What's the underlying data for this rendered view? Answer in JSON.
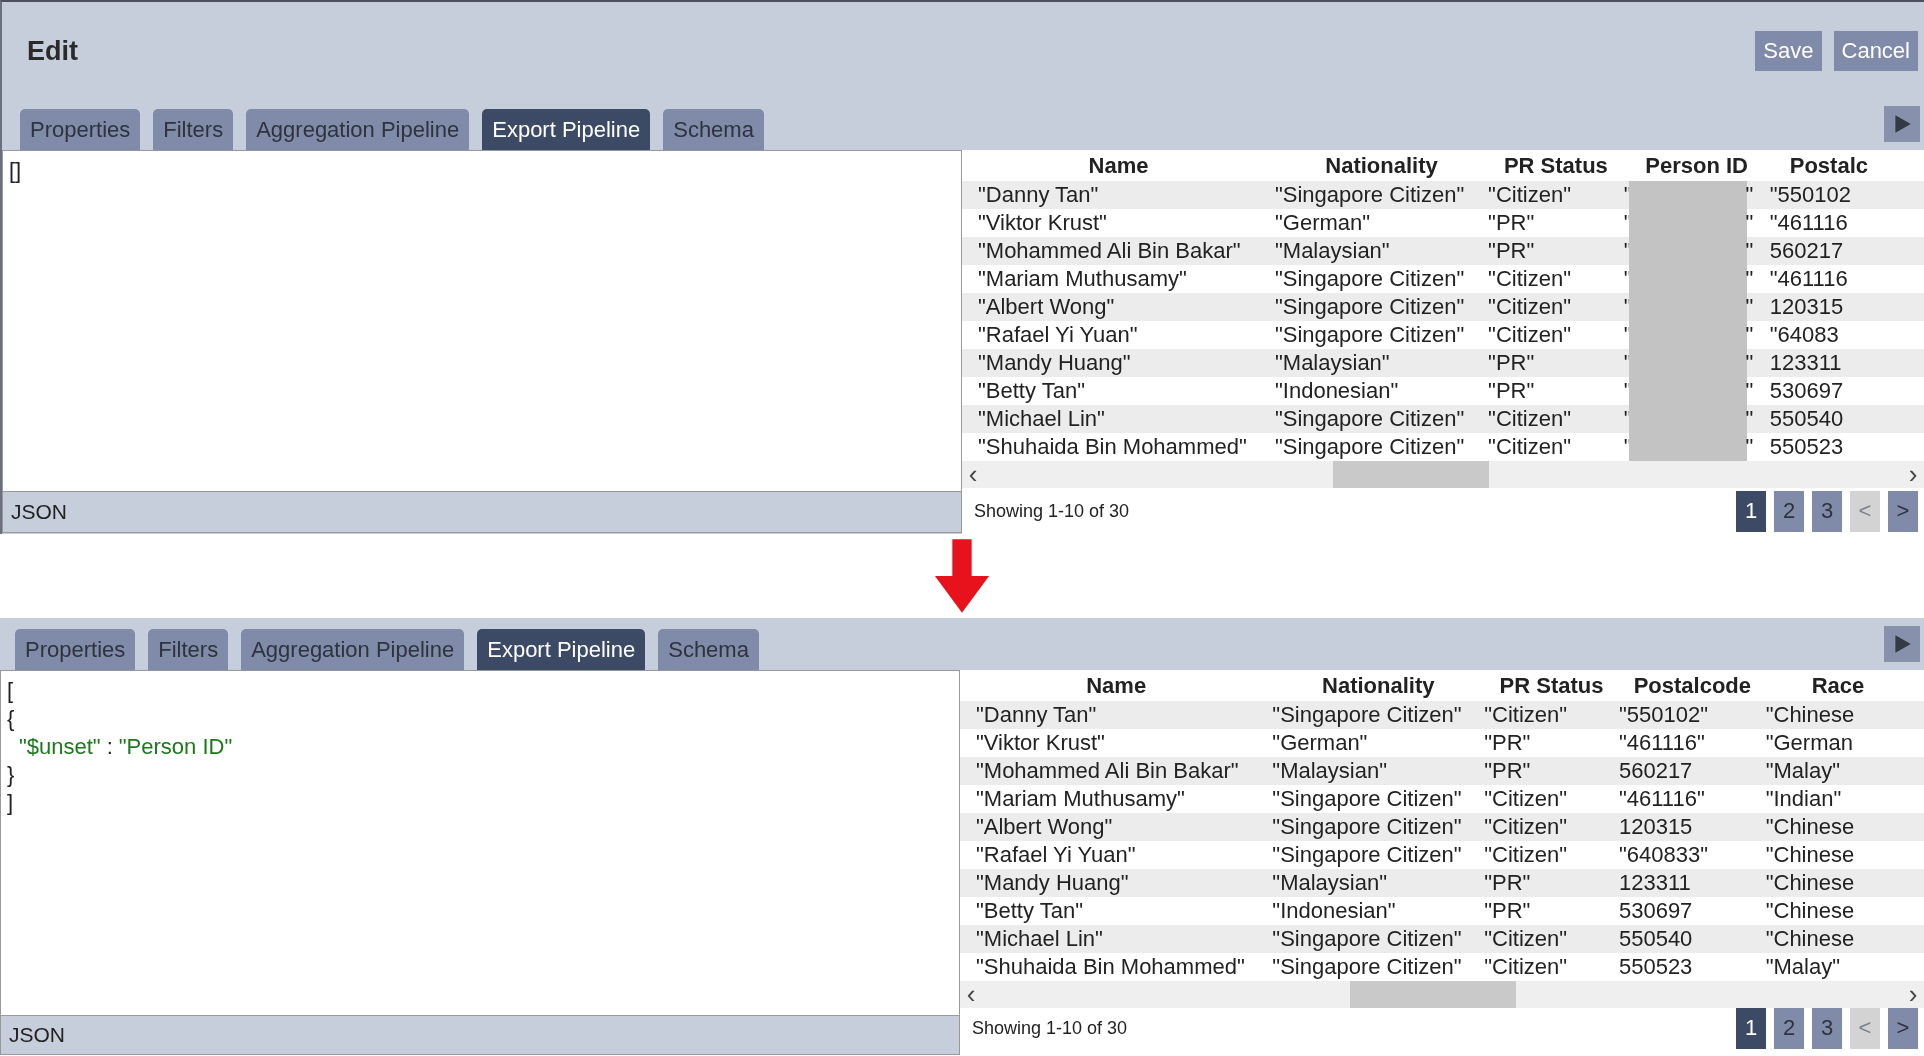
{
  "dialog": {
    "title": "Edit",
    "buttons": [
      "Save",
      "Cancel"
    ]
  },
  "panels": [
    {
      "tabs": [
        {
          "label": "Properties",
          "selected": false
        },
        {
          "label": "Filters",
          "selected": false
        },
        {
          "label": "Aggregation Pipeline",
          "selected": false
        },
        {
          "label": "Export Pipeline",
          "selected": true
        },
        {
          "label": "Schema",
          "selected": false
        }
      ],
      "editor": {
        "lines": [
          {
            "nested": false,
            "segments": [
              {
                "text": "[]",
                "kind": "punct"
              }
            ]
          }
        ],
        "label": "JSON"
      },
      "table": {
        "columns": [
          {
            "label": "Name",
            "kind": "text"
          },
          {
            "label": "Nationality",
            "kind": "text"
          },
          {
            "label": "PR Status",
            "kind": "text"
          },
          {
            "label": "Person ID",
            "kind": "redacted"
          },
          {
            "label": "Postalc",
            "kind": "text"
          }
        ],
        "rows": [
          [
            "\"Danny Tan\"",
            "\"Singapore Citizen\"",
            "\"Citizen\"",
            {
              "start": "\"",
              "end": "\""
            },
            "\"550102"
          ],
          [
            "\"Viktor Krust\"",
            "\"German\"",
            "\"PR\"",
            {
              "start": "\"",
              "end": "\""
            },
            "\"461116"
          ],
          [
            "\"Mohammed Ali Bin Bakar\"",
            "\"Malaysian\"",
            "\"PR\"",
            {
              "start": "\"",
              "end": "\""
            },
            "560217"
          ],
          [
            "\"Mariam Muthusamy\"",
            "\"Singapore Citizen\"",
            "\"Citizen\"",
            {
              "start": "\"",
              "end": "\""
            },
            "\"461116"
          ],
          [
            "\"Albert Wong\"",
            "\"Singapore Citizen\"",
            "\"Citizen\"",
            {
              "start": "\"",
              "end": "\""
            },
            "120315"
          ],
          [
            "\"Rafael Yi Yuan\"",
            "\"Singapore Citizen\"",
            "\"Citizen\"",
            {
              "start": "\"",
              "end": "\""
            },
            "\"64083"
          ],
          [
            "\"Mandy Huang\"",
            "\"Malaysian\"",
            "\"PR\"",
            {
              "start": "\"",
              "end": "\""
            },
            "123311"
          ],
          [
            "\"Betty Tan\"",
            "\"Indonesian\"",
            "\"PR\"",
            {
              "start": "\"",
              "end": "\""
            },
            "530697"
          ],
          [
            "\"Michael Lin\"",
            "\"Singapore Citizen\"",
            "\"Citizen\"",
            {
              "start": "\"",
              "end": "\""
            },
            "550540"
          ],
          [
            "\"Shuhaida Bin Mohammed\"",
            "\"Singapore Citizen\"",
            "\"Citizen\"",
            {
              "start": "\"",
              "end": "\""
            },
            "550523"
          ]
        ],
        "scroll_arrows": [
          "‹",
          "›"
        ],
        "showing": "Showing 1-10 of 30",
        "pages": [
          {
            "label": "1",
            "selected": true,
            "disabled": false
          },
          {
            "label": "2",
            "selected": false,
            "disabled": false
          },
          {
            "label": "3",
            "selected": false,
            "disabled": false
          },
          {
            "label": "<",
            "selected": false,
            "disabled": true
          },
          {
            "label": ">",
            "selected": false,
            "disabled": false
          }
        ]
      }
    },
    {
      "tabs": [
        {
          "label": "Properties",
          "selected": false
        },
        {
          "label": "Filters",
          "selected": false
        },
        {
          "label": "Aggregation Pipeline",
          "selected": false
        },
        {
          "label": "Export Pipeline",
          "selected": true
        },
        {
          "label": "Schema",
          "selected": false
        }
      ],
      "editor": {
        "lines": [
          {
            "nested": false,
            "segments": [
              {
                "text": "[",
                "kind": "punct"
              }
            ]
          },
          {
            "nested": false,
            "segments": [
              {
                "text": "{",
                "kind": "punct"
              }
            ]
          },
          {
            "nested": true,
            "segments": [
              {
                "text": "\"$unset\"",
                "kind": "string"
              },
              {
                "text": ":",
                "kind": "punct"
              },
              {
                "text": "\"Person ID\"",
                "kind": "string"
              }
            ]
          },
          {
            "nested": false,
            "segments": [
              {
                "text": "}",
                "kind": "punct"
              }
            ]
          },
          {
            "nested": false,
            "segments": [
              {
                "text": "]",
                "kind": "punct"
              }
            ]
          }
        ],
        "label": "JSON"
      },
      "table": {
        "columns": [
          {
            "label": "Name",
            "kind": "text"
          },
          {
            "label": "Nationality",
            "kind": "text"
          },
          {
            "label": "PR Status",
            "kind": "text"
          },
          {
            "label": "Postalcode",
            "kind": "text"
          },
          {
            "label": "Race",
            "kind": "text"
          }
        ],
        "rows": [
          [
            "\"Danny Tan\"",
            "\"Singapore Citizen\"",
            "\"Citizen\"",
            "\"550102\"",
            "\"Chinese"
          ],
          [
            "\"Viktor Krust\"",
            "\"German\"",
            "\"PR\"",
            "\"461116\"",
            "\"German"
          ],
          [
            "\"Mohammed Ali Bin Bakar\"",
            "\"Malaysian\"",
            "\"PR\"",
            "560217",
            "\"Malay\""
          ],
          [
            "\"Mariam Muthusamy\"",
            "\"Singapore Citizen\"",
            "\"Citizen\"",
            "\"461116\"",
            "\"Indian\""
          ],
          [
            "\"Albert Wong\"",
            "\"Singapore Citizen\"",
            "\"Citizen\"",
            "120315",
            "\"Chinese"
          ],
          [
            "\"Rafael Yi Yuan\"",
            "\"Singapore Citizen\"",
            "\"Citizen\"",
            "\"640833\"",
            "\"Chinese"
          ],
          [
            "\"Mandy Huang\"",
            "\"Malaysian\"",
            "\"PR\"",
            "123311",
            "\"Chinese"
          ],
          [
            "\"Betty Tan\"",
            "\"Indonesian\"",
            "\"PR\"",
            "530697",
            "\"Chinese"
          ],
          [
            "\"Michael Lin\"",
            "\"Singapore Citizen\"",
            "\"Citizen\"",
            "550540",
            "\"Chinese"
          ],
          [
            "\"Shuhaida Bin Mohammed\"",
            "\"Singapore Citizen\"",
            "\"Citizen\"",
            "550523",
            "\"Malay\""
          ]
        ],
        "scroll_arrows": [
          "‹",
          "›"
        ],
        "showing": "Showing 1-10 of 30",
        "pages": [
          {
            "label": "1",
            "selected": true,
            "disabled": false
          },
          {
            "label": "2",
            "selected": false,
            "disabled": false
          },
          {
            "label": "3",
            "selected": false,
            "disabled": false
          },
          {
            "label": "<",
            "selected": false,
            "disabled": true
          },
          {
            "label": ">",
            "selected": false,
            "disabled": false
          }
        ]
      }
    }
  ]
}
